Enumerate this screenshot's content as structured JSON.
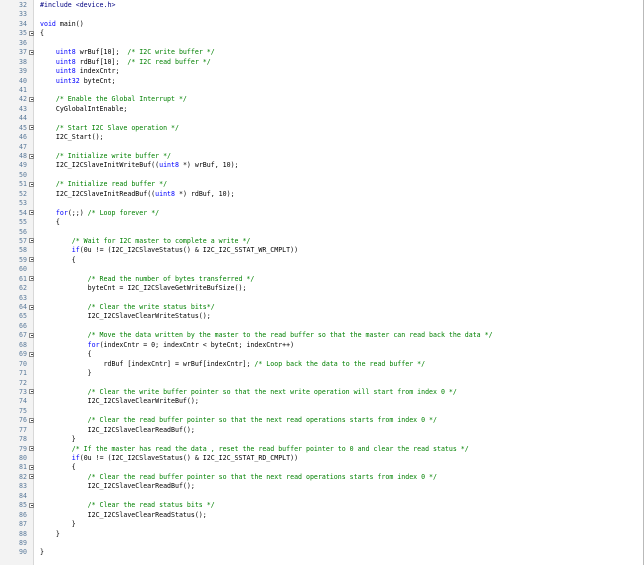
{
  "editor": {
    "lines": [
      {
        "n": "32",
        "fold": false,
        "indent": "",
        "parts": [
          {
            "t": "#include <device.h>",
            "c": "pp"
          }
        ]
      },
      {
        "n": "33",
        "fold": false,
        "indent": "",
        "parts": []
      },
      {
        "n": "34",
        "fold": false,
        "indent": "",
        "parts": [
          {
            "t": "void",
            "c": "kw"
          },
          {
            "t": " main()",
            "c": "pn"
          }
        ]
      },
      {
        "n": "35",
        "fold": true,
        "indent": "",
        "parts": [
          {
            "t": "{",
            "c": "pn"
          }
        ]
      },
      {
        "n": "36",
        "fold": false,
        "indent": "",
        "parts": []
      },
      {
        "n": "37",
        "fold": true,
        "indent": "    ",
        "parts": [
          {
            "t": "uint8",
            "c": "ty"
          },
          {
            "t": " wrBuf[10];  ",
            "c": "pn"
          },
          {
            "t": "/* I2C write buffer */",
            "c": "cm"
          }
        ]
      },
      {
        "n": "38",
        "fold": false,
        "indent": "    ",
        "parts": [
          {
            "t": "uint8",
            "c": "ty"
          },
          {
            "t": " rdBuf[10];  ",
            "c": "pn"
          },
          {
            "t": "/* I2C read buffer */",
            "c": "cm"
          }
        ]
      },
      {
        "n": "39",
        "fold": false,
        "indent": "    ",
        "parts": [
          {
            "t": "uint8",
            "c": "ty"
          },
          {
            "t": " indexCntr;",
            "c": "pn"
          }
        ]
      },
      {
        "n": "40",
        "fold": false,
        "indent": "    ",
        "parts": [
          {
            "t": "uint32",
            "c": "ty"
          },
          {
            "t": " byteCnt;",
            "c": "pn"
          }
        ]
      },
      {
        "n": "41",
        "fold": false,
        "indent": "",
        "parts": []
      },
      {
        "n": "42",
        "fold": true,
        "indent": "    ",
        "parts": [
          {
            "t": "/* Enable the Global Interrupt */",
            "c": "cm"
          }
        ]
      },
      {
        "n": "43",
        "fold": false,
        "indent": "    ",
        "parts": [
          {
            "t": "CyGlobalIntEnable;",
            "c": "pn"
          }
        ]
      },
      {
        "n": "44",
        "fold": false,
        "indent": "",
        "parts": []
      },
      {
        "n": "45",
        "fold": true,
        "indent": "    ",
        "parts": [
          {
            "t": "/* Start I2C Slave operation */",
            "c": "cm"
          }
        ]
      },
      {
        "n": "46",
        "fold": false,
        "indent": "    ",
        "parts": [
          {
            "t": "I2C_Start();",
            "c": "pn"
          }
        ]
      },
      {
        "n": "47",
        "fold": false,
        "indent": "",
        "parts": []
      },
      {
        "n": "48",
        "fold": true,
        "indent": "    ",
        "parts": [
          {
            "t": "/* Initialize write buffer */",
            "c": "cm"
          }
        ]
      },
      {
        "n": "49",
        "fold": false,
        "indent": "    ",
        "parts": [
          {
            "t": "I2C_I2CSlaveInitWriteBuf((",
            "c": "pn"
          },
          {
            "t": "uint8",
            "c": "ty"
          },
          {
            "t": " *) wrBuf, 10);",
            "c": "pn"
          }
        ]
      },
      {
        "n": "50",
        "fold": false,
        "indent": "",
        "parts": []
      },
      {
        "n": "51",
        "fold": true,
        "indent": "    ",
        "parts": [
          {
            "t": "/* Initialize read buffer */",
            "c": "cm"
          }
        ]
      },
      {
        "n": "52",
        "fold": false,
        "indent": "    ",
        "parts": [
          {
            "t": "I2C_I2CSlaveInitReadBuf((",
            "c": "pn"
          },
          {
            "t": "uint8",
            "c": "ty"
          },
          {
            "t": " *) rdBuf, 10);",
            "c": "pn"
          }
        ]
      },
      {
        "n": "53",
        "fold": false,
        "indent": "",
        "parts": []
      },
      {
        "n": "54",
        "fold": true,
        "indent": "    ",
        "parts": [
          {
            "t": "for",
            "c": "kw"
          },
          {
            "t": "(;;) ",
            "c": "pn"
          },
          {
            "t": "/* Loop forever */",
            "c": "cm"
          }
        ]
      },
      {
        "n": "55",
        "fold": false,
        "indent": "    ",
        "parts": [
          {
            "t": "{",
            "c": "pn"
          }
        ]
      },
      {
        "n": "56",
        "fold": false,
        "indent": "",
        "parts": []
      },
      {
        "n": "57",
        "fold": true,
        "indent": "        ",
        "parts": [
          {
            "t": "/* Wait for I2C master to complete a write */",
            "c": "cm"
          }
        ]
      },
      {
        "n": "58",
        "fold": false,
        "indent": "        ",
        "parts": [
          {
            "t": "if",
            "c": "kw"
          },
          {
            "t": "(0u != (I2C_I2CSlaveStatus() & I2C_I2C_SSTAT_WR_CMPLT))",
            "c": "pn"
          }
        ]
      },
      {
        "n": "59",
        "fold": true,
        "indent": "        ",
        "parts": [
          {
            "t": "{",
            "c": "pn"
          }
        ]
      },
      {
        "n": "60",
        "fold": false,
        "indent": "",
        "parts": []
      },
      {
        "n": "61",
        "fold": true,
        "indent": "            ",
        "parts": [
          {
            "t": "/* Read the number of bytes transferred */",
            "c": "cm"
          }
        ]
      },
      {
        "n": "62",
        "fold": false,
        "indent": "            ",
        "parts": [
          {
            "t": "byteCnt = I2C_I2CSlaveGetWriteBufSize();",
            "c": "pn"
          }
        ]
      },
      {
        "n": "63",
        "fold": false,
        "indent": "",
        "parts": []
      },
      {
        "n": "64",
        "fold": true,
        "indent": "            ",
        "parts": [
          {
            "t": "/* Clear the write status bits*/",
            "c": "cm"
          }
        ]
      },
      {
        "n": "65",
        "fold": false,
        "indent": "            ",
        "parts": [
          {
            "t": "I2C_I2CSlaveClearWriteStatus();",
            "c": "pn"
          }
        ]
      },
      {
        "n": "66",
        "fold": false,
        "indent": "",
        "parts": []
      },
      {
        "n": "67",
        "fold": true,
        "indent": "            ",
        "parts": [
          {
            "t": "/* Move the data written by the master to the read buffer so that the master can read back the data */",
            "c": "cm"
          }
        ]
      },
      {
        "n": "68",
        "fold": false,
        "indent": "            ",
        "parts": [
          {
            "t": "for",
            "c": "kw"
          },
          {
            "t": "(indexCntr = 0; indexCntr < byteCnt; indexCntr++)",
            "c": "pn"
          }
        ]
      },
      {
        "n": "69",
        "fold": true,
        "indent": "            ",
        "parts": [
          {
            "t": "{",
            "c": "pn"
          }
        ]
      },
      {
        "n": "70",
        "fold": false,
        "indent": "                ",
        "parts": [
          {
            "t": "rdBuf [indexCntr] = wrBuf[indexCntr]; ",
            "c": "pn"
          },
          {
            "t": "/* Loop back the data to the read buffer */",
            "c": "cm"
          }
        ]
      },
      {
        "n": "71",
        "fold": false,
        "indent": "            ",
        "parts": [
          {
            "t": "}",
            "c": "pn"
          }
        ]
      },
      {
        "n": "72",
        "fold": false,
        "indent": "",
        "parts": []
      },
      {
        "n": "73",
        "fold": true,
        "indent": "            ",
        "parts": [
          {
            "t": "/* Clear the write buffer pointer so that the next write operation will start from index 0 */",
            "c": "cm"
          }
        ]
      },
      {
        "n": "74",
        "fold": false,
        "indent": "            ",
        "parts": [
          {
            "t": "I2C_I2CSlaveClearWriteBuf();",
            "c": "pn"
          }
        ]
      },
      {
        "n": "75",
        "fold": false,
        "indent": "",
        "parts": []
      },
      {
        "n": "76",
        "fold": true,
        "indent": "            ",
        "parts": [
          {
            "t": "/* Clear the read buffer pointer so that the next read operations starts from index 0 */",
            "c": "cm"
          }
        ]
      },
      {
        "n": "77",
        "fold": false,
        "indent": "            ",
        "parts": [
          {
            "t": "I2C_I2CSlaveClearReadBuf();",
            "c": "pn"
          }
        ]
      },
      {
        "n": "78",
        "fold": false,
        "indent": "        ",
        "parts": [
          {
            "t": "}",
            "c": "pn"
          }
        ]
      },
      {
        "n": "79",
        "fold": true,
        "indent": "        ",
        "parts": [
          {
            "t": "/* If the master has read the data , reset the read buffer pointer to 0 and clear the read status */",
            "c": "cm"
          }
        ]
      },
      {
        "n": "80",
        "fold": false,
        "indent": "        ",
        "parts": [
          {
            "t": "if",
            "c": "kw"
          },
          {
            "t": "(0u != (I2C_I2CSlaveStatus() & I2C_I2C_SSTAT_RD_CMPLT))",
            "c": "pn"
          }
        ]
      },
      {
        "n": "81",
        "fold": true,
        "indent": "        ",
        "parts": [
          {
            "t": "{",
            "c": "pn"
          }
        ]
      },
      {
        "n": "82",
        "fold": true,
        "indent": "            ",
        "parts": [
          {
            "t": "/* Clear the read buffer pointer so that the next read operations starts from index 0 */",
            "c": "cm"
          }
        ]
      },
      {
        "n": "83",
        "fold": false,
        "indent": "            ",
        "parts": [
          {
            "t": "I2C_I2CSlaveClearReadBuf();",
            "c": "pn"
          }
        ]
      },
      {
        "n": "84",
        "fold": false,
        "indent": "",
        "parts": []
      },
      {
        "n": "85",
        "fold": true,
        "indent": "            ",
        "parts": [
          {
            "t": "/* Clear the read status bits */",
            "c": "cm"
          }
        ]
      },
      {
        "n": "86",
        "fold": false,
        "indent": "            ",
        "parts": [
          {
            "t": "I2C_I2CSlaveClearReadStatus();",
            "c": "pn"
          }
        ]
      },
      {
        "n": "87",
        "fold": false,
        "indent": "        ",
        "parts": [
          {
            "t": "}",
            "c": "pn"
          }
        ]
      },
      {
        "n": "88",
        "fold": false,
        "indent": "    ",
        "parts": [
          {
            "t": "}",
            "c": "pn"
          }
        ]
      },
      {
        "n": "89",
        "fold": false,
        "indent": "",
        "parts": []
      },
      {
        "n": "90",
        "fold": false,
        "indent": "",
        "parts": [
          {
            "t": "}",
            "c": "pn"
          }
        ]
      }
    ]
  },
  "colors": {
    "keyword": "#0000ff",
    "comment": "#008000",
    "preprocessor": "#000080",
    "line_number": "#5a7a9a",
    "gutter": "#f3f3f3"
  }
}
